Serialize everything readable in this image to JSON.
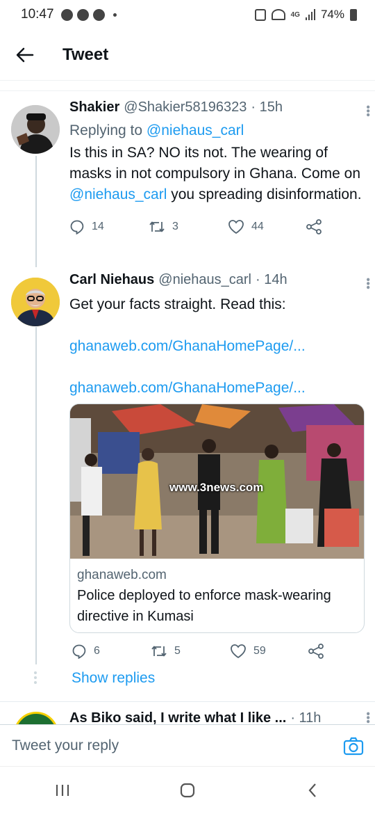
{
  "status_bar": {
    "time": "10:47",
    "network": "4G",
    "battery": "74%"
  },
  "header": {
    "title": "Tweet",
    "back_icon": "arrow-left-icon"
  },
  "tweets": [
    {
      "name": "Shakier",
      "handle": "@Shakier58196323",
      "time": "· 15h",
      "replying_prefix": "Replying to",
      "replying_to": "@niehaus_carl",
      "text_1": "Is this in SA? NO its not. The wearing of masks in not compulsory in Ghana. Come on",
      "mention": "@niehaus_carl",
      "text_2": "you spreading disinformation.",
      "replies": "14",
      "retweets": "3",
      "likes": "44"
    },
    {
      "name": "Carl Niehaus",
      "handle": "@niehaus_carl",
      "time": "· 14h",
      "text": "Get your facts straight. Read this:",
      "url_1": "ghanaweb.com/GhanaHomePage/...",
      "url_2": "ghanaweb.com/GhanaHomePage/...",
      "card": {
        "watermark": "www.3news.com",
        "domain": "ghanaweb.com",
        "title": "Police deployed to enforce mask-wearing directive in Kumasi"
      },
      "replies": "6",
      "retweets": "5",
      "likes": "59"
    }
  ],
  "show_replies": "Show replies",
  "next_tweet": {
    "name": "As Biko said, I write what I like ...",
    "time": "· 11h"
  },
  "reply_bar": {
    "placeholder": "Tweet your reply"
  },
  "colors": {
    "accent": "#1d9bf0",
    "secondary_text": "#536471",
    "border": "#cfd9de"
  }
}
